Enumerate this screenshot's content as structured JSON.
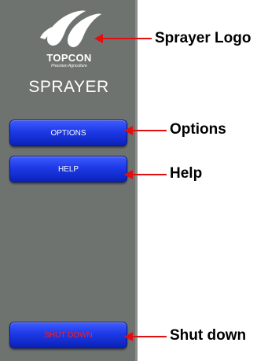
{
  "panel": {
    "brand": "TOPCON",
    "brand_sub": "Precision Agriculture",
    "title": "SPRAYER"
  },
  "buttons": {
    "options": "OPTIONS",
    "help": "HELP",
    "shutdown": "SHUT DOWN"
  },
  "callouts": {
    "logo": "Sprayer Logo",
    "options": "Options",
    "help": "Help",
    "shutdown": "Shut down"
  },
  "colors": {
    "panel": "#6f7370",
    "button": "#1d39e6",
    "arrow": "#e01010",
    "shutdown_text": "#ff1d1d"
  }
}
